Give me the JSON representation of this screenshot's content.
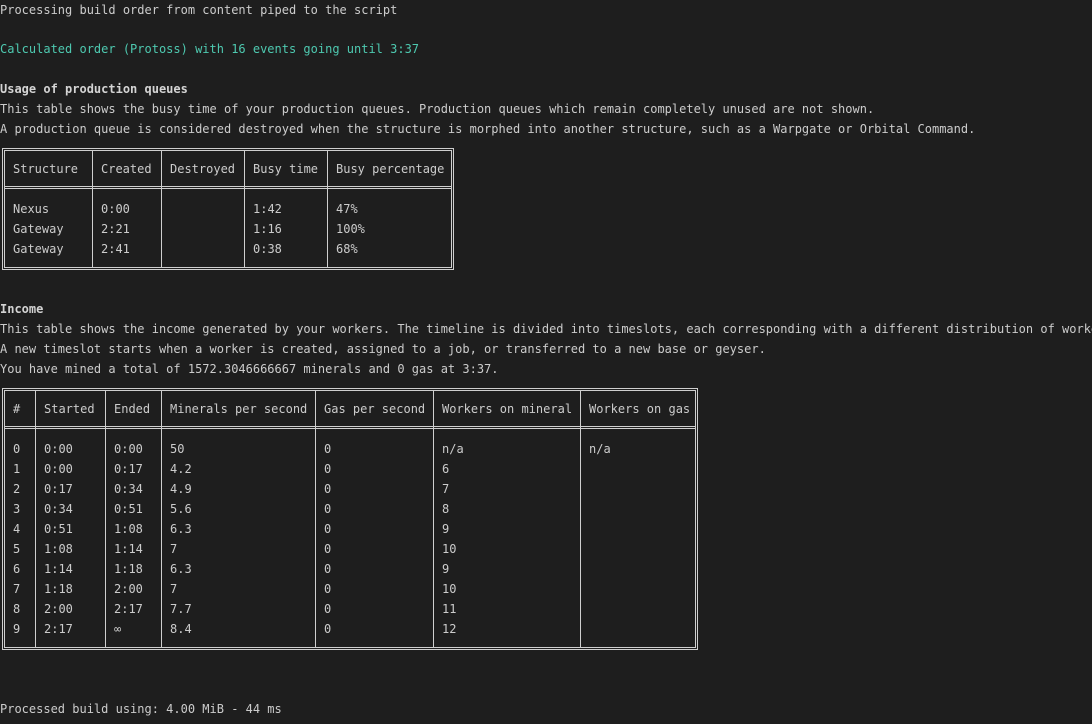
{
  "header": {
    "processing": "Processing build order from content piped to the script",
    "calculated": "Calculated order (Protoss) with 16 events going until 3:37"
  },
  "queues": {
    "title": "Usage of production queues",
    "desc1": "This table shows the busy time of your production queues. Production queues which remain completely unused are not shown.",
    "desc2": "A production queue is considered destroyed when the structure is morphed into another structure, such as a Warpgate or Orbital Command.",
    "columns": [
      "Structure",
      "Created",
      "Destroyed",
      "Busy time",
      "Busy percentage"
    ],
    "rows": [
      [
        "Nexus",
        "0:00",
        "",
        "1:42",
        "47%"
      ],
      [
        "Gateway",
        "2:21",
        "",
        "1:16",
        "100%"
      ],
      [
        "Gateway",
        "2:41",
        "",
        "0:38",
        "68%"
      ]
    ]
  },
  "income": {
    "title": "Income",
    "desc1": "This table shows the income generated by your workers. The timeline is divided into timeslots, each corresponding with a different distribution of workers.",
    "desc2": "A new timeslot starts when a worker is created, assigned to a job, or transferred to a new base or geyser.",
    "total": "You have mined a total of 1572.3046666667 minerals and 0 gas at 3:37.",
    "columns": [
      "#",
      "Started",
      "Ended",
      "Minerals per second",
      "Gas per second",
      "Workers on mineral",
      "Workers on gas"
    ],
    "rows": [
      [
        "0",
        "0:00",
        "0:00",
        "50",
        "0",
        "n/a",
        "n/a"
      ],
      [
        "1",
        "0:00",
        "0:17",
        "4.2",
        "0",
        "6",
        ""
      ],
      [
        "2",
        "0:17",
        "0:34",
        "4.9",
        "0",
        "7",
        ""
      ],
      [
        "3",
        "0:34",
        "0:51",
        "5.6",
        "0",
        "8",
        ""
      ],
      [
        "4",
        "0:51",
        "1:08",
        "6.3",
        "0",
        "9",
        ""
      ],
      [
        "5",
        "1:08",
        "1:14",
        "7",
        "0",
        "10",
        ""
      ],
      [
        "6",
        "1:14",
        "1:18",
        "6.3",
        "0",
        "9",
        ""
      ],
      [
        "7",
        "1:18",
        "2:00",
        "7",
        "0",
        "10",
        ""
      ],
      [
        "8",
        "2:00",
        "2:17",
        "7.7",
        "0",
        "11",
        ""
      ],
      [
        "9",
        "2:17",
        "∞",
        "8.4",
        "0",
        "12",
        ""
      ]
    ]
  },
  "footer": {
    "processed": "Processed build using: 4.00 MiB - 44 ms"
  }
}
